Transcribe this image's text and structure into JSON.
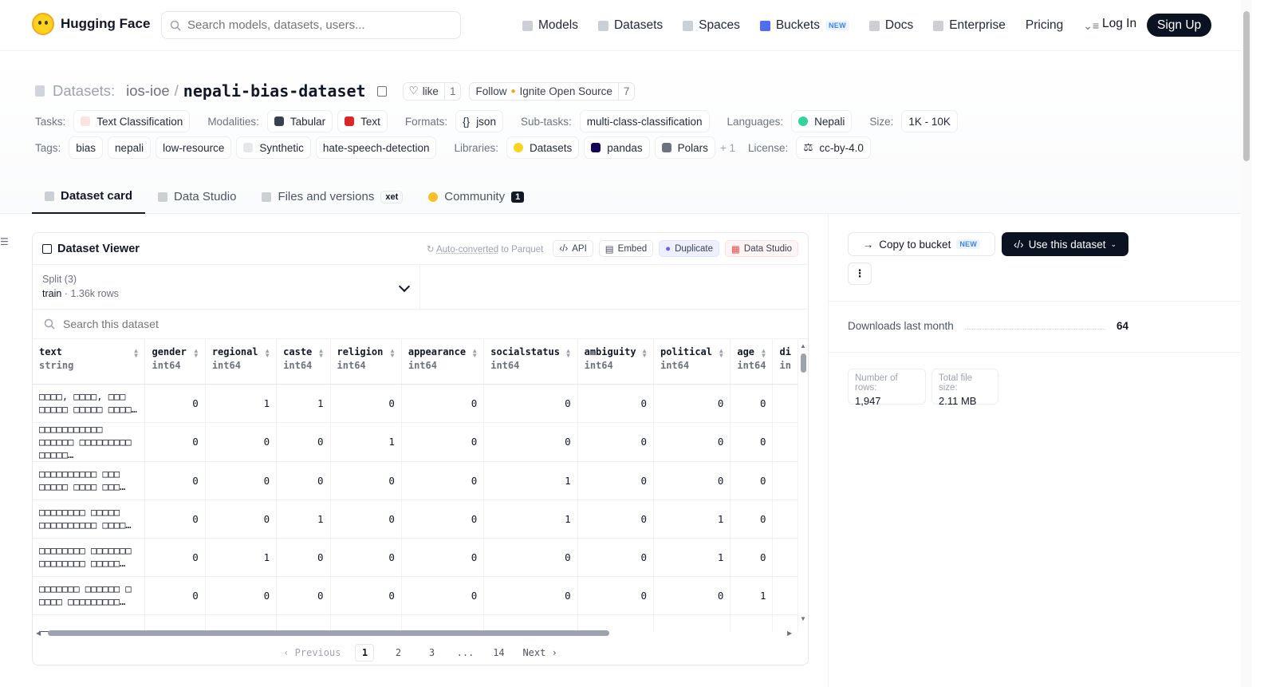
{
  "brand": {
    "name": "Hugging Face"
  },
  "search": {
    "placeholder": "Search models, datasets, users..."
  },
  "nav": {
    "items": [
      {
        "label": "Models"
      },
      {
        "label": "Datasets"
      },
      {
        "label": "Spaces"
      },
      {
        "label": "Buckets",
        "badge": "NEW"
      },
      {
        "label": "Docs"
      },
      {
        "label": "Enterprise"
      },
      {
        "label": "Pricing"
      }
    ],
    "login": "Log In",
    "signup": "Sign Up"
  },
  "dataset": {
    "section": "Datasets:",
    "org": "ios-ioe",
    "slash": "/",
    "name": "nepali-bias-dataset",
    "like_label": "like",
    "like_count": "1",
    "follow_label": "Follow",
    "follow_org": "Ignite Open Source",
    "follow_count": "7"
  },
  "meta_row1": {
    "tasks_label": "Tasks:",
    "task": "Text Classification",
    "modalities_label": "Modalities:",
    "modality1": "Tabular",
    "modality2": "Text",
    "formats_label": "Formats:",
    "format": "json",
    "subtasks_label": "Sub-tasks:",
    "subtask": "multi-class-classification",
    "languages_label": "Languages:",
    "language": "Nepali",
    "size_label": "Size:",
    "size": "1K - 10K"
  },
  "meta_row2": {
    "tags_label": "Tags:",
    "tags": [
      "bias",
      "nepali",
      "low-resource",
      "Synthetic",
      "hate-speech-detection"
    ],
    "libraries_label": "Libraries:",
    "libraries": [
      "Datasets",
      "pandas",
      "Polars"
    ],
    "more": "+ 1",
    "license_label": "License:",
    "license": "cc-by-4.0"
  },
  "tabs": [
    {
      "label": "Dataset card"
    },
    {
      "label": "Data Studio"
    },
    {
      "label": "Files and versions",
      "badge": "xet"
    },
    {
      "label": "Community",
      "badge": "1"
    }
  ],
  "viewer": {
    "title": "Dataset Viewer",
    "auto_converted": "Auto-converted",
    "to_parquet": "to Parquet",
    "api": "API",
    "embed": "Embed",
    "duplicate": "Duplicate",
    "data_studio": "Data Studio",
    "split_label": "Split (3)",
    "split_name": "train",
    "split_rows": "1.36k rows",
    "search_placeholder": "Search this dataset",
    "columns": [
      {
        "name": "text",
        "type": "string"
      },
      {
        "name": "gender",
        "type": "int64"
      },
      {
        "name": "regional",
        "type": "int64"
      },
      {
        "name": "caste",
        "type": "int64"
      },
      {
        "name": "religion",
        "type": "int64"
      },
      {
        "name": "appearance",
        "type": "int64"
      },
      {
        "name": "socialstatus",
        "type": "int64"
      },
      {
        "name": "ambiguity",
        "type": "int64"
      },
      {
        "name": "political",
        "type": "int64"
      },
      {
        "name": "age",
        "type": "int64"
      },
      {
        "name": "di",
        "type": "in"
      }
    ],
    "rows": [
      {
        "text": "□□□□, □□□□, □□□ □□□□□ □□□□□ □□□□…",
        "values": [
          "0",
          "1",
          "1",
          "0",
          "0",
          "0",
          "0",
          "0",
          "0"
        ]
      },
      {
        "text": "□□□□□□□□□□□ □□□□□□ □□□□□□□□□ □□□□□…",
        "values": [
          "0",
          "0",
          "0",
          "1",
          "0",
          "0",
          "0",
          "0",
          "0"
        ]
      },
      {
        "text": "□□□□□□□□□□ □□□ □□□□□ □□□□ □□□…",
        "values": [
          "0",
          "0",
          "0",
          "0",
          "0",
          "1",
          "0",
          "0",
          "0"
        ]
      },
      {
        "text": "□□□□□□□□ □□□□□ □□□□□□□□□□ □□□□…",
        "values": [
          "0",
          "0",
          "1",
          "0",
          "0",
          "1",
          "0",
          "1",
          "0"
        ]
      },
      {
        "text": "□□□□□□□□ □□□□□□□ □□□□□□□□ □□□□□…",
        "values": [
          "0",
          "1",
          "0",
          "0",
          "0",
          "0",
          "0",
          "1",
          "0"
        ]
      },
      {
        "text": "□□□□□□□ □□□□□□ □ □□□□ □□□□□□□□□…",
        "values": [
          "0",
          "0",
          "0",
          "0",
          "0",
          "0",
          "0",
          "0",
          "1"
        ]
      },
      {
        "text": "□□□□□ □□□□□□□",
        "values": [
          "",
          "",
          "",
          "",
          "",
          "",
          "",
          "",
          ""
        ]
      }
    ],
    "pager": {
      "prev": "Previous",
      "pages": [
        "1",
        "2",
        "3",
        "...",
        "14"
      ],
      "next": "Next"
    }
  },
  "sidebar": {
    "copy_bucket": "Copy to bucket",
    "copy_badge": "NEW",
    "use_dataset": "Use this dataset",
    "downloads_label": "Downloads last month",
    "downloads_value": "64",
    "rows_label": "Number of rows:",
    "rows_value": "1,947",
    "size_label": "Total file size:",
    "size_value": "2.11 MB"
  },
  "colors": {
    "accent_dark": "#0b1221",
    "hf_yellow": "#ffd21e"
  }
}
